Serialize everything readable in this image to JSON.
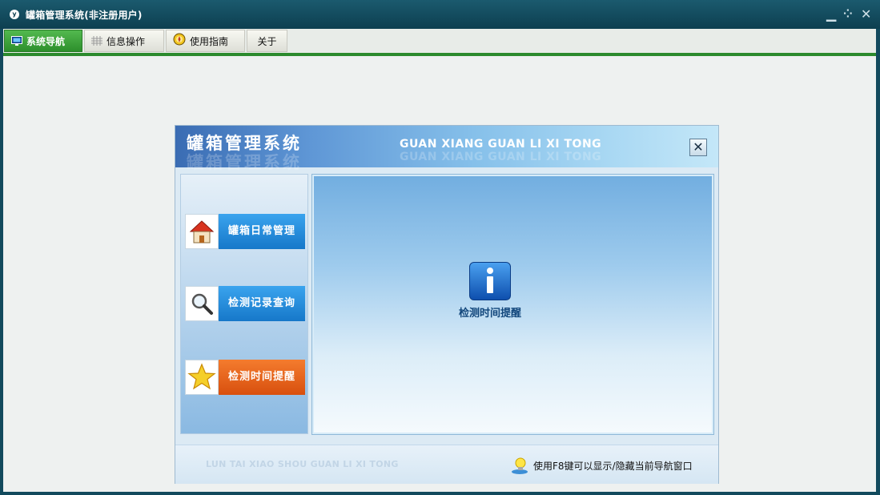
{
  "window": {
    "app_icon_glyph": "y",
    "title": "罐箱管理系统(非注册用户)",
    "controls": {
      "minimize": "▁",
      "maximize": "⁘",
      "close": "✕"
    }
  },
  "menu": {
    "tabs": [
      {
        "label": "系统导航",
        "icon": "monitor-icon",
        "active": true
      },
      {
        "label": "信息操作",
        "icon": "grid-icon",
        "active": false
      },
      {
        "label": "使用指南",
        "icon": "compass-icon",
        "active": false
      },
      {
        "label": "关于",
        "icon": "",
        "active": false
      }
    ]
  },
  "nav_window": {
    "title_cn": "罐箱管理系统",
    "title_en": "GUAN XIANG GUAN LI XI TONG",
    "close_glyph": "✕",
    "nav_buttons": [
      {
        "label": "罐箱日常管理",
        "icon": "house-icon",
        "active": false
      },
      {
        "label": "检测记录查询",
        "icon": "magnifier-icon",
        "active": false
      },
      {
        "label": "检测时间提醒",
        "icon": "star-icon",
        "active": true
      }
    ],
    "panel": {
      "info_glyph": "i",
      "label": "检测时间提醒"
    },
    "footer": {
      "watermark": "LUN TAI XIAO SHOU GUAN LI XI TONG",
      "hint": "使用F8键可以显示/隐藏当前导航窗口"
    }
  },
  "colors": {
    "titlebar": "#124a5d",
    "active_tab": "#3a9f37",
    "nav_button": "#1e8ad9",
    "nav_button_active": "#e5651e",
    "panel_blue": "#72aee0"
  }
}
